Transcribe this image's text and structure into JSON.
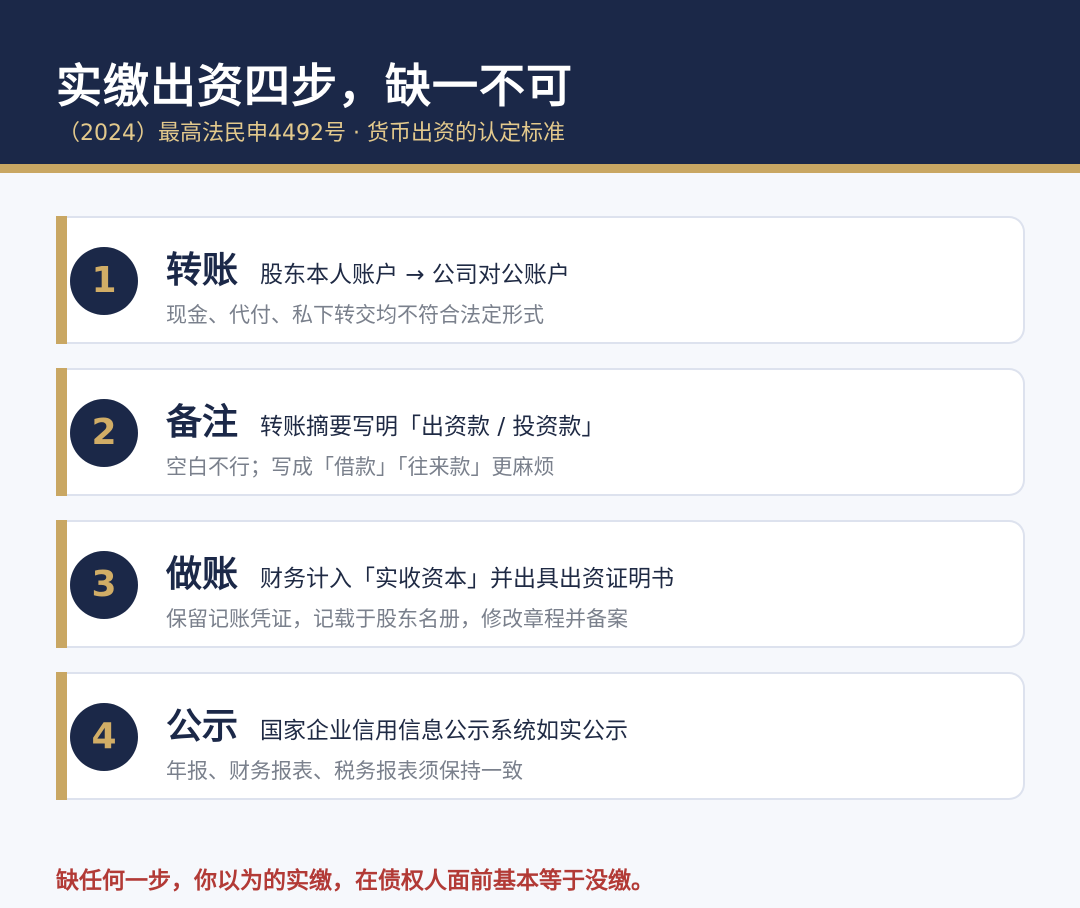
{
  "header": {
    "title": "实缴出资四步，缺一不可",
    "subtitle": "（2024）最高法民申4492号 · 货币出资的认定标准"
  },
  "steps": [
    {
      "number": "1",
      "name": "转账",
      "desc": "股东本人账户 → 公司对公账户",
      "note": "现金、代付、私下转交均不符合法定形式"
    },
    {
      "number": "2",
      "name": "备注",
      "desc": "转账摘要写明「出资款 / 投资款」",
      "note": "空白不行；写成「借款」「往来款」更麻烦"
    },
    {
      "number": "3",
      "name": "做账",
      "desc": "财务计入「实收资本」并出具出资证明书",
      "note": "保留记账凭证，记载于股东名册，修改章程并备案"
    },
    {
      "number": "4",
      "name": "公示",
      "desc": "国家企业信用信息公示系统如实公示",
      "note": "年报、财务报表、税务报表须保持一致"
    }
  ],
  "footer": {
    "text": "缺任何一步，你以为的实缴，在债权人面前基本等于没缴。"
  },
  "colors": {
    "header_bg": "#1b2848",
    "accent_gold": "#c9a763",
    "warning_red": "#b23a36"
  }
}
